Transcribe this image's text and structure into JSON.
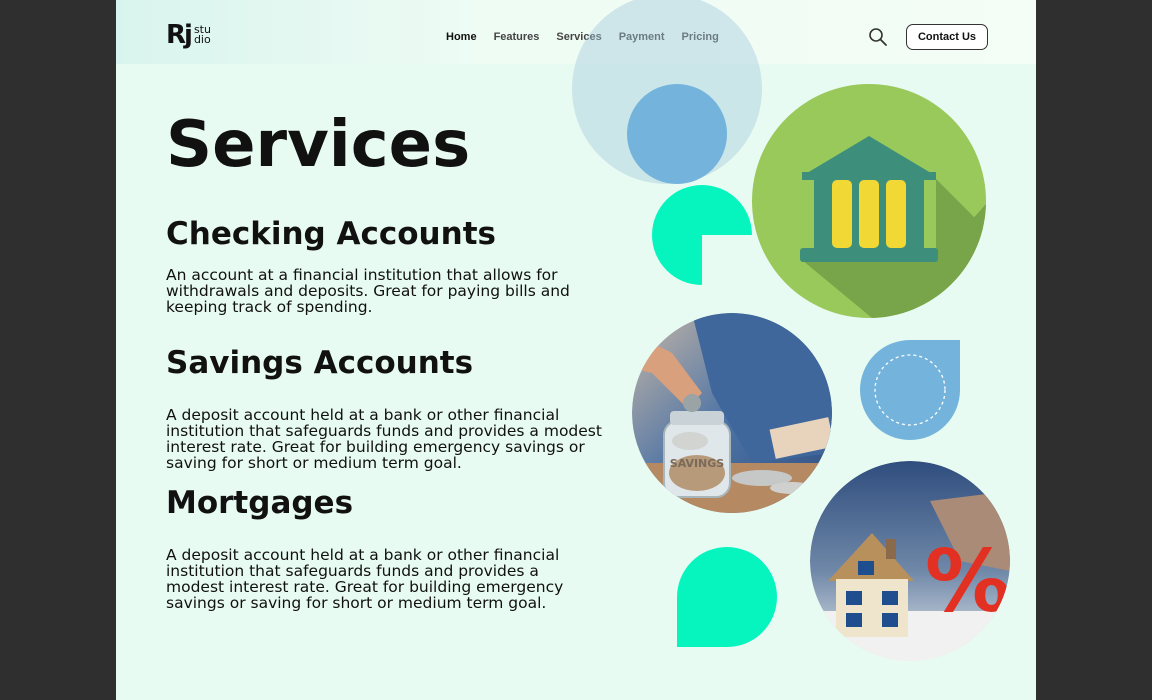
{
  "logo": {
    "mark": "Rj",
    "word_top": "stu",
    "word_bottom": "dio"
  },
  "nav": [
    {
      "label": "Home",
      "active": true
    },
    {
      "label": "Features"
    },
    {
      "label": "Services"
    },
    {
      "label": "Payment"
    },
    {
      "label": "Pricing"
    }
  ],
  "header": {
    "contact_label": "Contact Us",
    "search_icon": "search-icon"
  },
  "main": {
    "title": "Services",
    "sections": [
      {
        "heading": "Checking Accounts",
        "body": "An account at a financial institution that allows for withdrawals and deposits. Great for paying bills and keeping track of spending."
      },
      {
        "heading": "Savings Accounts",
        "body": "A deposit account held at a bank or other financial institution that safeguards funds and provides a modest interest rate. Great for building emergency savings or saving for short or medium term goal."
      },
      {
        "heading": "Mortgages",
        "body": "A deposit account held at a bank or other financial institution that safeguards funds and provides a modest interest rate. Great for building emergency savings or saving for short or medium term goal."
      }
    ]
  },
  "illustrations": {
    "savings_jar_label": "SAVINGS",
    "house_percent": "%"
  },
  "colors": {
    "page_bg": "#e8fbf2",
    "accent_teal": "#06f5bf",
    "accent_blue": "#74b4dc",
    "accent_green": "#99c95a",
    "bank_teal": "#3d8f7c",
    "bank_yellow": "#f2d835"
  }
}
